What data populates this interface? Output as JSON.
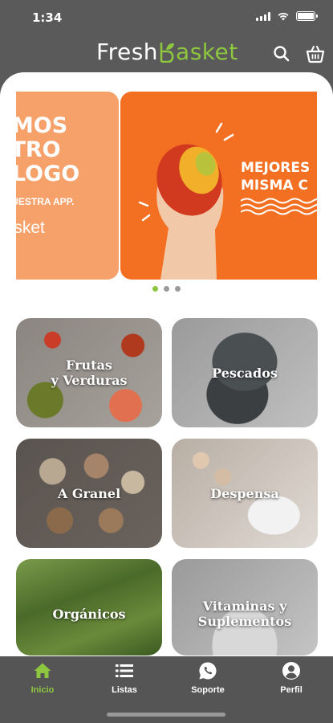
{
  "status_bar": {
    "time": "1:34",
    "battery_level": 1.0
  },
  "header": {
    "logo_part1": "Fresh",
    "logo_part2": "asket",
    "logo_color": "#8dc63f",
    "search_icon": "search-icon",
    "cart_icon": "basket-icon"
  },
  "carousel": {
    "slide1": {
      "lines": [
        "AMOS",
        "STRO",
        "ÁLOGO"
      ],
      "subtitle": "A NUESTRA APP.",
      "logo": "basket"
    },
    "slide2": {
      "line1": "MEJORES",
      "line2": "MISMA C"
    },
    "page_count": 3,
    "active_page": 1
  },
  "categories": [
    {
      "line1": "Frutas",
      "line2": "y Verduras"
    },
    {
      "line1": "Pescados",
      "line2": ""
    },
    {
      "line1": "A Granel",
      "line2": ""
    },
    {
      "line1": "Despensa",
      "line2": ""
    },
    {
      "line1": "Orgánicos",
      "line2": ""
    },
    {
      "line1": "Vitaminas y",
      "line2": "Suplementos"
    }
  ],
  "tabbar": {
    "items": [
      {
        "label": "Inicio",
        "icon": "home-icon",
        "active": true
      },
      {
        "label": "Listas",
        "icon": "list-icon",
        "active": false
      },
      {
        "label": "Soporte",
        "icon": "whatsapp-icon",
        "active": false
      },
      {
        "label": "Perfil",
        "icon": "user-icon",
        "active": false
      }
    ],
    "active_color": "#8dc63f"
  }
}
